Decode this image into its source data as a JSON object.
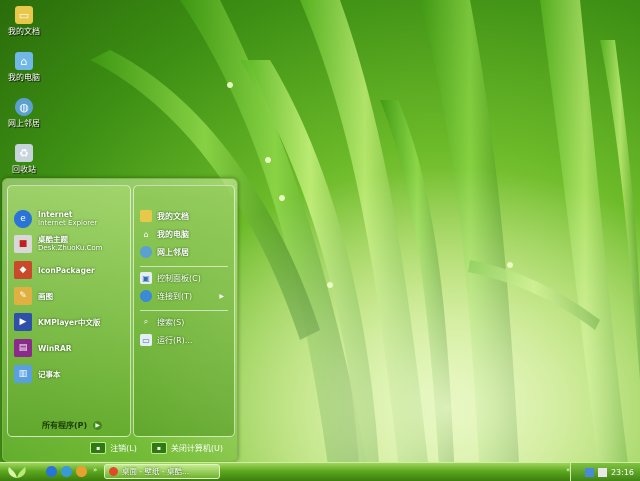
{
  "desktop": {
    "icons": [
      {
        "label": "我的文档",
        "icon": "folder-icon"
      },
      {
        "label": "我的电脑",
        "icon": "computer-icon"
      },
      {
        "label": "网上邻居",
        "icon": "network-icon"
      },
      {
        "label": "回收站",
        "icon": "recycle-bin-icon"
      }
    ]
  },
  "start_menu": {
    "programs": [
      {
        "title": "Internet",
        "subtitle": "Internet Explorer",
        "icon": "ie-icon",
        "color": "#2a73d8"
      },
      {
        "title": "桌酷主题",
        "subtitle": "Desk.ZhuoKu.Com",
        "icon": "zhuoku-icon",
        "color": "#d8d8d8"
      },
      {
        "title": "IconPackager",
        "subtitle": "",
        "icon": "iconpackager-icon",
        "color": "#c84a2a"
      },
      {
        "title": "画图",
        "subtitle": "",
        "icon": "paint-icon",
        "color": "#e0b040"
      },
      {
        "title": "KMPlayer中文版",
        "subtitle": "",
        "icon": "kmplayer-icon",
        "color": "#2f4fa8"
      },
      {
        "title": "WinRAR",
        "subtitle": "",
        "icon": "winrar-icon",
        "color": "#8a2a8a"
      },
      {
        "title": "记事本",
        "subtitle": "",
        "icon": "notepad-icon",
        "color": "#5aa0e0"
      }
    ],
    "all_programs": "所有程序(P)",
    "places": [
      {
        "label": "我的文档",
        "icon": "folder-icon",
        "bold": true
      },
      {
        "label": "我的电脑",
        "icon": "computer-icon",
        "bold": true
      },
      {
        "label": "网上邻居",
        "icon": "network-icon",
        "bold": true
      },
      {
        "label": "控制面板(C)",
        "icon": "control-panel-icon",
        "bold": false
      },
      {
        "label": "连接到(T)",
        "icon": "connect-icon",
        "bold": false
      },
      {
        "label": "搜索(S)",
        "icon": "search-icon",
        "bold": false
      },
      {
        "label": "运行(R)...",
        "icon": "run-icon",
        "bold": false
      }
    ],
    "logoff": "注销(L)",
    "shutdown": "关闭计算机(U)"
  },
  "taskbar": {
    "task": "桌面 - 壁纸 - 桌酷...",
    "clock": "23:16"
  },
  "colors": {
    "accent": "#5da81f",
    "menu_border": "#7fb84a"
  }
}
